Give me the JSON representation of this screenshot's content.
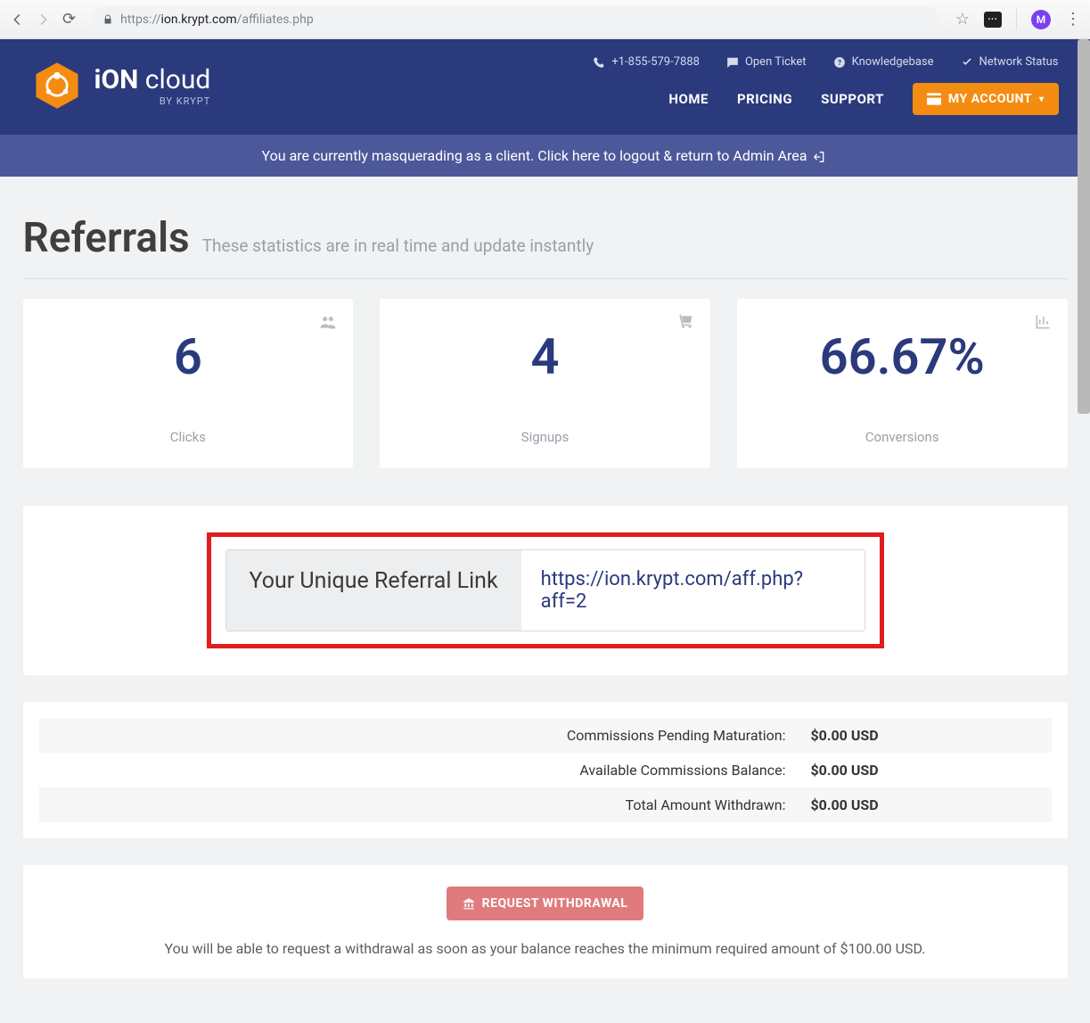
{
  "browser": {
    "url_prefix": "https://",
    "url_host": "ion.krypt.com",
    "url_path": "/affiliates.php",
    "avatar_letter": "M"
  },
  "brand": {
    "name_strong": "iON",
    "name_light": " cloud",
    "byline": "BY KRYPT"
  },
  "topbar": {
    "phone": "+1-855-579-7888",
    "ticket": "Open Ticket",
    "kb": "Knowledgebase",
    "status": "Network Status"
  },
  "nav": {
    "home": "HOME",
    "pricing": "PRICING",
    "support": "SUPPORT",
    "account": "MY ACCOUNT"
  },
  "masquerade": "You are currently masquerading as a client. Click here to logout & return to Admin Area",
  "page": {
    "title": "Referrals",
    "subtitle": "These statistics are in real time and update instantly"
  },
  "stats": {
    "clicks": {
      "value": "6",
      "label": "Clicks"
    },
    "signups": {
      "value": "4",
      "label": "Signups"
    },
    "conversions": {
      "value": "66.67%",
      "label": "Conversions"
    }
  },
  "referral": {
    "label": "Your Unique Referral Link",
    "link": "https://ion.krypt.com/aff.php?aff=2"
  },
  "balances": {
    "rows": [
      {
        "label": "Commissions Pending Maturation:",
        "value": "$0.00 USD"
      },
      {
        "label": "Available Commissions Balance:",
        "value": "$0.00 USD"
      },
      {
        "label": "Total Amount Withdrawn:",
        "value": "$0.00 USD"
      }
    ]
  },
  "withdraw": {
    "button": "REQUEST WITHDRAWAL",
    "note": "You will be able to request a withdrawal as soon as your balance reaches the minimum required amount of $100.00 USD."
  }
}
